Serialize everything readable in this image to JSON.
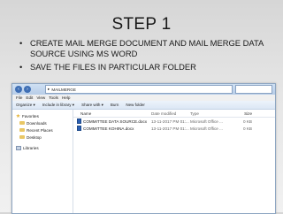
{
  "slide": {
    "title": "STEP 1",
    "bullets": [
      "CREATE   MAIL MERGE DOCUMENT AND  MAIL MERGE DATA SOURCE  USING MS WORD",
      "SAVE THE FILES IN PARTICULAR FOLDER"
    ]
  },
  "explorer": {
    "path": "MAILMERGE",
    "menu": [
      "File",
      "Edit",
      "View",
      "Tools",
      "Help"
    ],
    "toolbar": [
      "Organize ▾",
      "Include in library ▾",
      "Share with ▾",
      "Burn",
      "New folder"
    ],
    "nav": [
      {
        "label": "Favorites",
        "icon": "star-icon"
      },
      {
        "label": "Downloads",
        "icon": "folder-icon"
      },
      {
        "label": "Recent Places",
        "icon": "folder-icon"
      },
      {
        "label": "Desktop",
        "icon": "folder-icon"
      },
      {
        "label": "Libraries",
        "icon": "library-icon"
      }
    ],
    "columns": {
      "name": "Name",
      "date": "Date modified",
      "type": "Type",
      "size": "Size"
    },
    "files": [
      {
        "name": "COMMITTEE DATA SOURCE.docx",
        "date": "13-11-2017 PM 01:...",
        "type": "Microsoft Office ...",
        "size": "0 KB"
      },
      {
        "name": "COMMITTEE KOHINA.docx",
        "date": "13-11-2017 PM 01:...",
        "type": "Microsoft Office ...",
        "size": "0 KB"
      }
    ]
  }
}
